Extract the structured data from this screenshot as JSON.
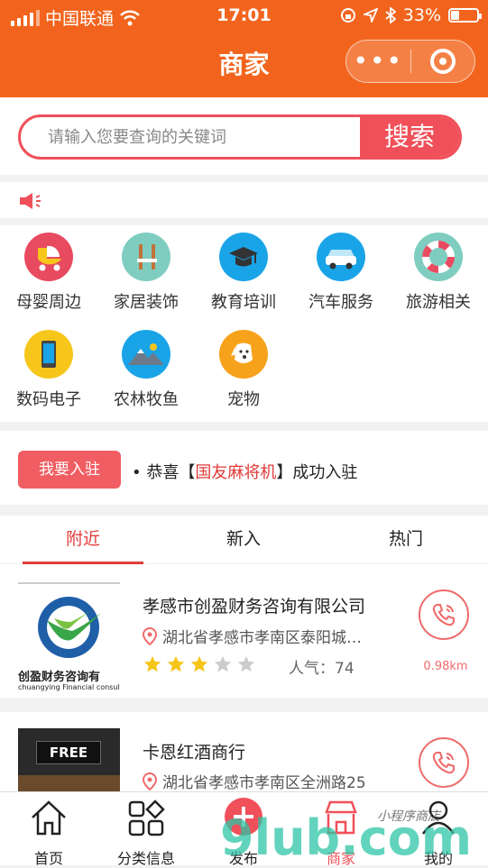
{
  "status_bar": {
    "carrier": "中国联通",
    "time": "17:01",
    "battery": "33%",
    "battery_level": 0.33
  },
  "nav": {
    "title": "商家"
  },
  "search": {
    "placeholder": "请输入您要查询的关键词",
    "button": "搜索"
  },
  "categories": [
    {
      "label": "母婴周边",
      "icon": "stroller-icon",
      "color": "#e84a5f"
    },
    {
      "label": "家居装饰",
      "icon": "chair-icon",
      "color": "#7ecdc0"
    },
    {
      "label": "教育培训",
      "icon": "graduation-cap-icon",
      "color": "#1aa4e8"
    },
    {
      "label": "汽车服务",
      "icon": "car-icon",
      "color": "#1aa4e8"
    },
    {
      "label": "旅游相关",
      "icon": "life-ring-icon",
      "color": "#7ecdc0"
    },
    {
      "label": "数码电子",
      "icon": "phone-icon",
      "color": "#f7c61b"
    },
    {
      "label": "农林牧鱼",
      "icon": "mountain-icon",
      "color": "#1aa4e8"
    },
    {
      "label": "宠物",
      "icon": "dog-icon",
      "color": "#f7a21b"
    }
  ],
  "join": {
    "button": "我要入驻",
    "prefix": "恭喜【",
    "highlight": "国友麻将机",
    "suffix": "】成功入驻"
  },
  "tabs": [
    {
      "label": "附近",
      "active": true
    },
    {
      "label": "新入",
      "active": false
    },
    {
      "label": "热门",
      "active": false
    }
  ],
  "merchants": [
    {
      "name": "孝感市创盈财务咨询有限公司",
      "address": "湖北省孝感市孝南区泰阳城…",
      "rating": 3,
      "rating_max": 5,
      "popularity": "人气：74",
      "distance": "0.98km",
      "logo_text": "创盈财务咨询有",
      "logo_subtext": "chuangying Financial consult"
    },
    {
      "name": "卡恩红酒商行",
      "address": "湖北省孝感市孝南区全洲路25",
      "thumb_text": "FREE"
    }
  ],
  "tabbar": [
    {
      "label": "首页",
      "icon": "home-icon"
    },
    {
      "label": "分类信息",
      "icon": "category-grid-icon"
    },
    {
      "label": "发布",
      "icon": "publish-plus-icon"
    },
    {
      "label": "商家",
      "icon": "shop-icon"
    },
    {
      "label": "我的",
      "icon": "user-icon"
    }
  ],
  "watermark": {
    "text": "9lub.com",
    "subtext": "小程序商店"
  },
  "colors": {
    "nav_bg": "#f2641d",
    "accent": "#f0505a",
    "star_on": "#f5c518",
    "star_off": "#cccccc"
  }
}
